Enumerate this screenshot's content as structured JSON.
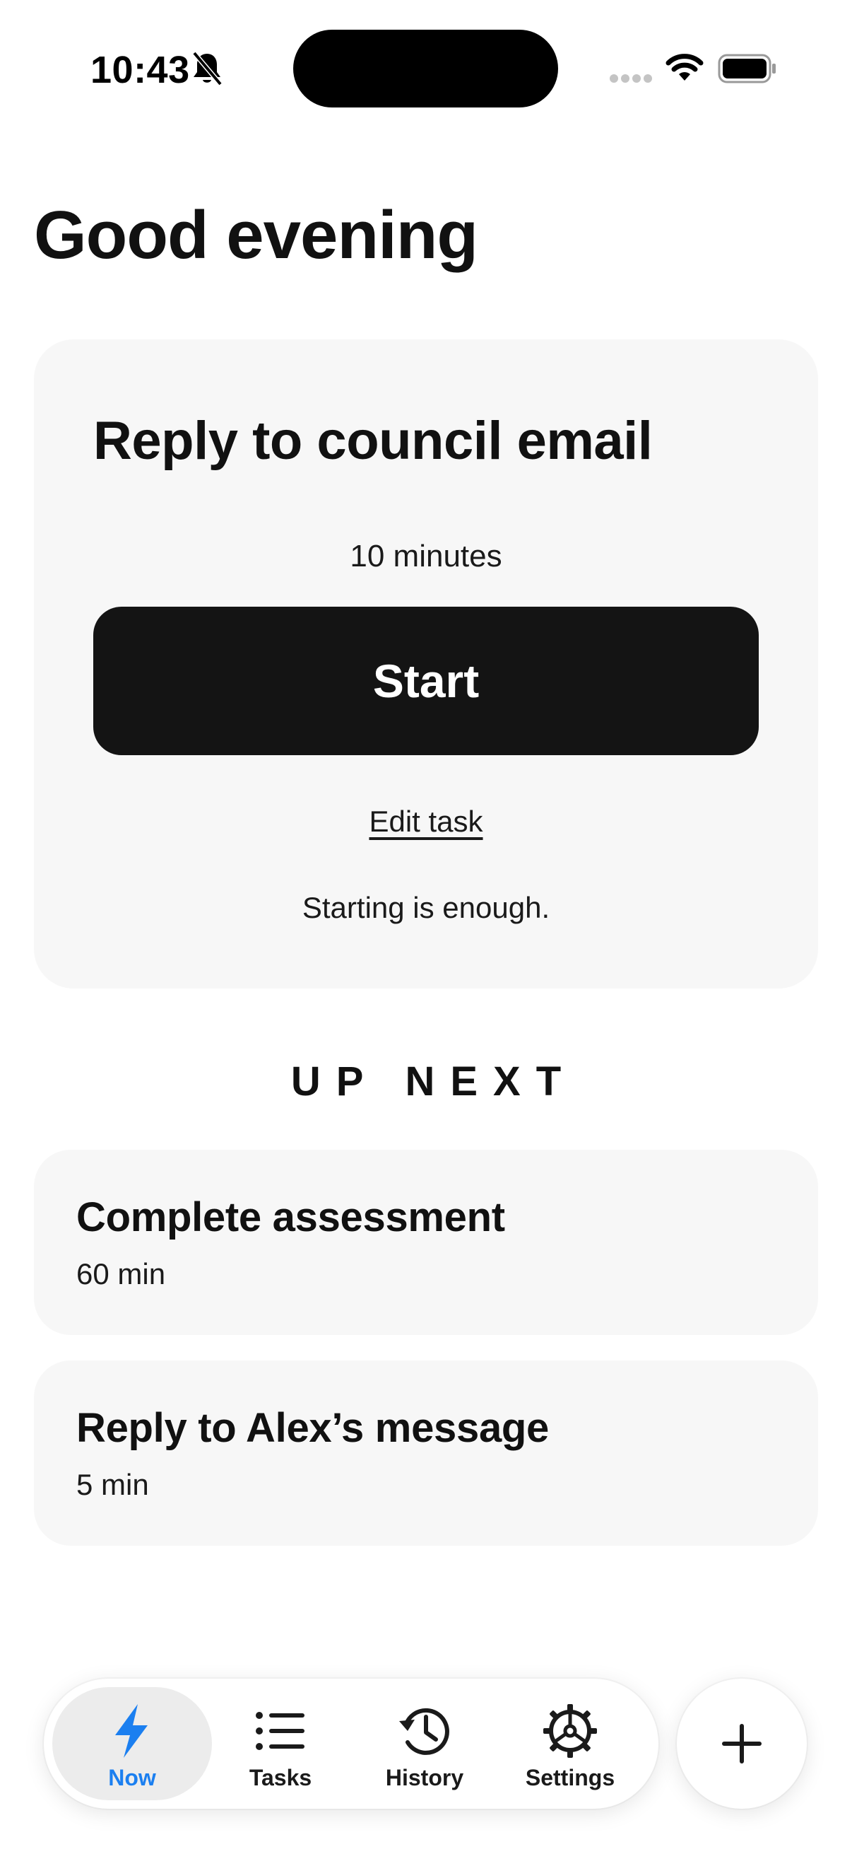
{
  "status_bar": {
    "time": "10:43",
    "icons": [
      "bell-muted-icon",
      "signal-dots-icon",
      "wifi-icon",
      "battery-icon"
    ]
  },
  "greeting": "Good evening",
  "current_task": {
    "title": "Reply to council email",
    "duration": "10 minutes",
    "start_label": "Start",
    "edit_label": "Edit task",
    "encouragement": "Starting is enough."
  },
  "up_next": {
    "heading": "UP NEXT",
    "items": [
      {
        "title": "Complete assessment",
        "duration": "60 min"
      },
      {
        "title": "Reply to Alex’s message",
        "duration": "5 min"
      }
    ]
  },
  "tab_bar": {
    "tabs": [
      {
        "label": "Now",
        "icon": "lightning-icon",
        "active": true
      },
      {
        "label": "Tasks",
        "icon": "list-icon",
        "active": false
      },
      {
        "label": "History",
        "icon": "history-icon",
        "active": false
      },
      {
        "label": "Settings",
        "icon": "gear-icon",
        "active": false
      }
    ],
    "add_icon": "plus-icon"
  },
  "colors": {
    "accent": "#1b7ff0",
    "card_background": "#f7f7f7",
    "primary_button": "#141414",
    "active_tab_background": "#ececec"
  }
}
